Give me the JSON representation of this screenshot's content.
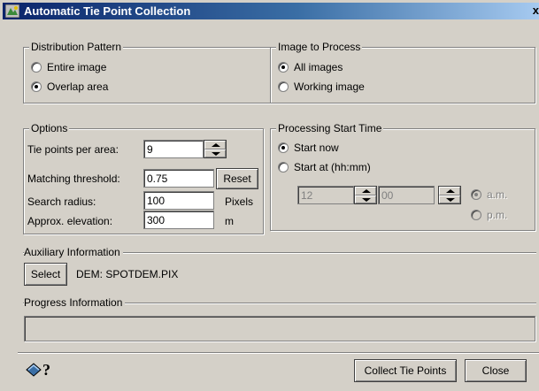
{
  "window": {
    "title": "Automatic Tie Point Collection",
    "close_label": "x"
  },
  "distribution": {
    "legend": "Distribution Pattern",
    "options": [
      {
        "label": "Entire image",
        "checked": false
      },
      {
        "label": "Overlap area",
        "checked": true
      }
    ]
  },
  "image_to_process": {
    "legend": "Image to Process",
    "options": [
      {
        "label": "All images",
        "checked": true
      },
      {
        "label": "Working image",
        "checked": false
      }
    ]
  },
  "options": {
    "legend": "Options",
    "tie_points_label": "Tie points per area:",
    "tie_points_value": "9",
    "matching_threshold_label": "Matching threshold:",
    "matching_threshold_value": "0.75",
    "reset_label": "Reset",
    "search_radius_label": "Search radius:",
    "search_radius_value": "100",
    "search_radius_unit": "Pixels",
    "approx_elevation_label": "Approx. elevation:",
    "approx_elevation_value": "300",
    "approx_elevation_unit": "m"
  },
  "processing": {
    "legend": "Processing Start Time",
    "start_now_label": "Start now",
    "start_now_checked": true,
    "start_at_label": "Start at (hh:mm)",
    "start_at_checked": false,
    "hour_value": "12",
    "minute_value": "00",
    "am_label": "a.m.",
    "pm_label": "p.m."
  },
  "auxiliary": {
    "label": "Auxiliary Information",
    "select_label": "Select",
    "dem_text": "DEM:  SPOTDEM.PIX"
  },
  "progress": {
    "label": "Progress Information"
  },
  "footer": {
    "help_icon": "help-book-icon",
    "collect_label": "Collect Tie Points",
    "close_label": "Close"
  }
}
